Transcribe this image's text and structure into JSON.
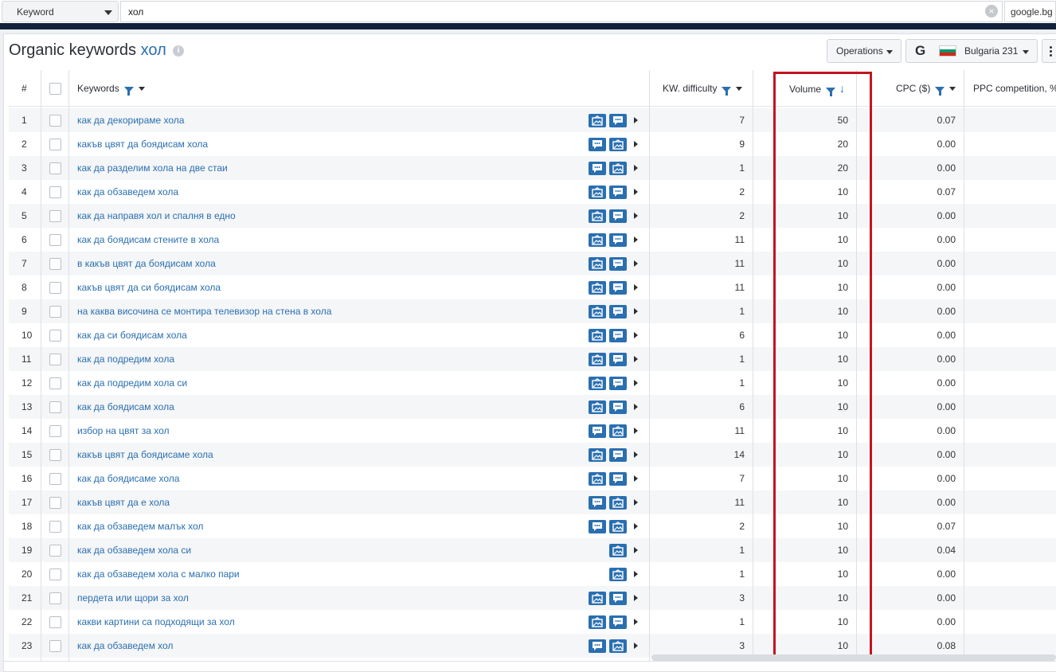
{
  "search": {
    "type_label": "Keyword",
    "query": "хол",
    "database": "google.bg"
  },
  "header": {
    "title_prefix": "Organic keywords",
    "title_query": "хол",
    "operations_label": "Operations",
    "region_label": "Bulgaria 231",
    "search_engine_icon": "G"
  },
  "columns": {
    "index": "#",
    "keywords": "Keywords",
    "kw_difficulty": "KW. difficulty",
    "volume": "Volume",
    "cpc": "CPC ($)",
    "ppc_competition": "PPC competition, %"
  },
  "colors": {
    "accent": "#2a6fb0",
    "highlight": "#c4141f",
    "nav": "#13223b"
  },
  "rows": [
    {
      "n": "1",
      "kw": "как да декорираме хола",
      "icons": [
        "image-icon",
        "comment-icon"
      ],
      "kd": "7",
      "vol": "50",
      "cpc": "0.07"
    },
    {
      "n": "2",
      "kw": "какъв цвят да боядисам хола",
      "icons": [
        "comment-icon",
        "image-icon"
      ],
      "kd": "9",
      "vol": "20",
      "cpc": "0.00"
    },
    {
      "n": "3",
      "kw": "как да разделим хола на две стаи",
      "icons": [
        "comment-icon",
        "image-icon"
      ],
      "kd": "1",
      "vol": "20",
      "cpc": "0.00"
    },
    {
      "n": "4",
      "kw": "как да обзаведем хола",
      "icons": [
        "image-icon",
        "comment-icon"
      ],
      "kd": "2",
      "vol": "10",
      "cpc": "0.07"
    },
    {
      "n": "5",
      "kw": "как да направя хол и спалня в едно",
      "icons": [
        "image-icon",
        "comment-icon"
      ],
      "kd": "2",
      "vol": "10",
      "cpc": "0.00"
    },
    {
      "n": "6",
      "kw": "как да боядисам стените в хола",
      "icons": [
        "image-icon",
        "comment-icon"
      ],
      "kd": "11",
      "vol": "10",
      "cpc": "0.00"
    },
    {
      "n": "7",
      "kw": "в какъв цвят да боядисам хола",
      "icons": [
        "image-icon",
        "comment-icon"
      ],
      "kd": "11",
      "vol": "10",
      "cpc": "0.00"
    },
    {
      "n": "8",
      "kw": "какъв цвят да си боядисам хола",
      "icons": [
        "image-icon",
        "comment-icon"
      ],
      "kd": "11",
      "vol": "10",
      "cpc": "0.00"
    },
    {
      "n": "9",
      "kw": "на каква височина се монтира телевизор на стена в хола",
      "icons": [
        "image-icon",
        "comment-icon"
      ],
      "kd": "1",
      "vol": "10",
      "cpc": "0.00"
    },
    {
      "n": "10",
      "kw": "как да си боядисам хола",
      "icons": [
        "image-icon",
        "comment-icon"
      ],
      "kd": "6",
      "vol": "10",
      "cpc": "0.00"
    },
    {
      "n": "11",
      "kw": "как да подредим хола",
      "icons": [
        "image-icon",
        "comment-icon"
      ],
      "kd": "1",
      "vol": "10",
      "cpc": "0.00"
    },
    {
      "n": "12",
      "kw": "как да подредим хола си",
      "icons": [
        "image-icon",
        "comment-icon"
      ],
      "kd": "1",
      "vol": "10",
      "cpc": "0.00"
    },
    {
      "n": "13",
      "kw": "как да боядисам хола",
      "icons": [
        "image-icon",
        "comment-icon"
      ],
      "kd": "6",
      "vol": "10",
      "cpc": "0.00"
    },
    {
      "n": "14",
      "kw": "избор на цвят за хол",
      "icons": [
        "comment-icon",
        "image-icon"
      ],
      "kd": "11",
      "vol": "10",
      "cpc": "0.00"
    },
    {
      "n": "15",
      "kw": "какъв цвят да боядисаме хола",
      "icons": [
        "image-icon",
        "comment-icon"
      ],
      "kd": "14",
      "vol": "10",
      "cpc": "0.00"
    },
    {
      "n": "16",
      "kw": "как да боядисаме хола",
      "icons": [
        "image-icon",
        "comment-icon"
      ],
      "kd": "7",
      "vol": "10",
      "cpc": "0.00"
    },
    {
      "n": "17",
      "kw": "какъв цвят да е хола",
      "icons": [
        "comment-icon",
        "image-icon"
      ],
      "kd": "11",
      "vol": "10",
      "cpc": "0.00"
    },
    {
      "n": "18",
      "kw": "как да обзаведем малък хол",
      "icons": [
        "comment-icon",
        "image-icon"
      ],
      "kd": "2",
      "vol": "10",
      "cpc": "0.07"
    },
    {
      "n": "19",
      "kw": "как да обзаведем хола си",
      "icons": [
        "image-icon"
      ],
      "kd": "1",
      "vol": "10",
      "cpc": "0.04"
    },
    {
      "n": "20",
      "kw": "как да обзаведем хола с малко пари",
      "icons": [
        "image-icon"
      ],
      "kd": "1",
      "vol": "10",
      "cpc": "0.00"
    },
    {
      "n": "21",
      "kw": "пердета или щори за хол",
      "icons": [
        "image-icon",
        "comment-icon"
      ],
      "kd": "3",
      "vol": "10",
      "cpc": "0.00"
    },
    {
      "n": "22",
      "kw": "какви картини са подходящи за хол",
      "icons": [
        "image-icon",
        "comment-icon"
      ],
      "kd": "1",
      "vol": "10",
      "cpc": "0.00"
    },
    {
      "n": "23",
      "kw": "как да обзаведем хол",
      "icons": [
        "comment-icon",
        "image-icon"
      ],
      "kd": "3",
      "vol": "10",
      "cpc": "0.08"
    }
  ]
}
